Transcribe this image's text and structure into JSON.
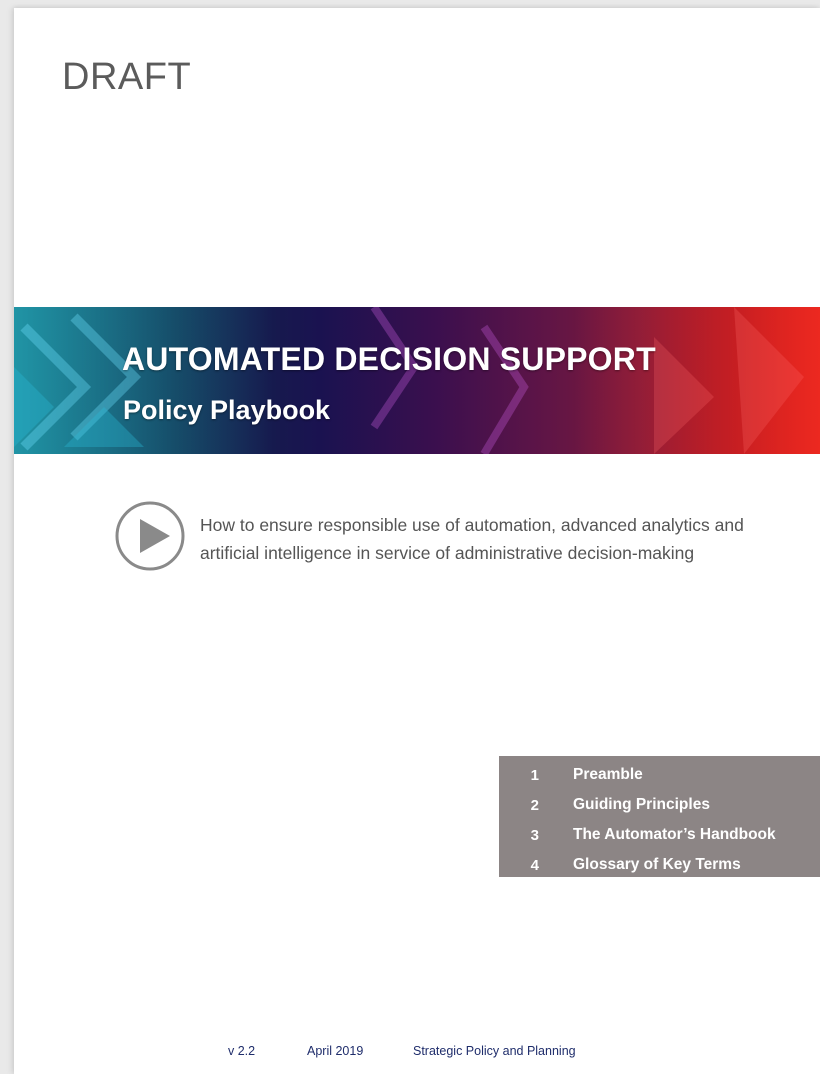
{
  "watermark": "DRAFT",
  "banner": {
    "title": "AUTOMATED DECISION SUPPORT",
    "subtitle": "Policy Playbook"
  },
  "tagline": {
    "line1": "How to ensure responsible use of automation, advanced analytics and",
    "line2": "artificial intelligence in service of administrative decision-making",
    "icon": "play-icon"
  },
  "toc": {
    "items": [
      {
        "num": "1",
        "label": "Preamble"
      },
      {
        "num": "2",
        "label": "Guiding Principles"
      },
      {
        "num": "3",
        "label": "The Automator’s Handbook"
      },
      {
        "num": "4",
        "label": "Glossary of Key Terms"
      }
    ]
  },
  "footer": {
    "version": "v 2.2",
    "date": "April 2019",
    "department": "Strategic Policy and Planning"
  },
  "colors": {
    "toc_background": "#8c8585",
    "footer_text": "#1f2d6b",
    "banner_start": "#0e4b5e",
    "banner_end": "#d00f12"
  }
}
